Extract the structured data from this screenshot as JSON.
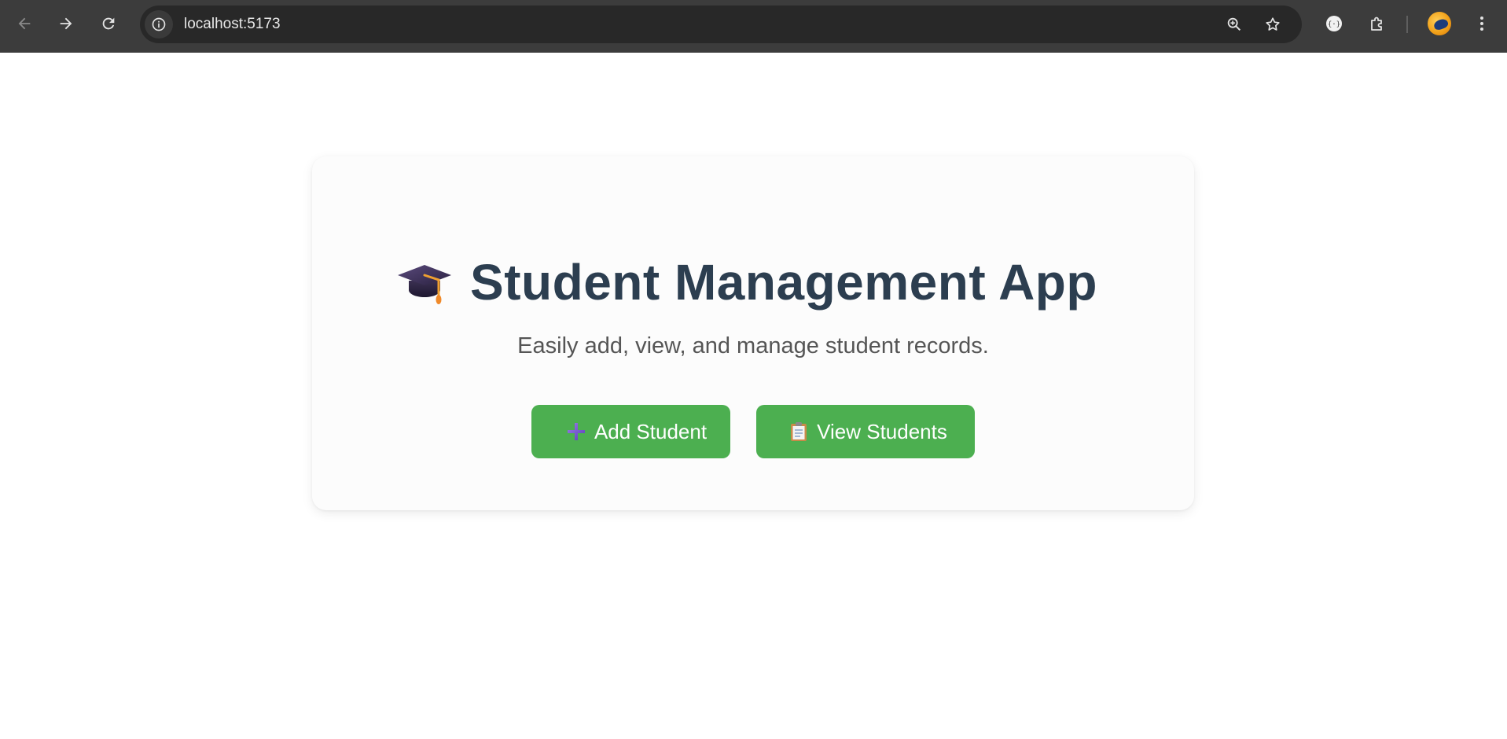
{
  "browser": {
    "url": "localhost:5173",
    "back_icon": "arrow-left-icon",
    "forward_icon": "arrow-right-icon",
    "reload_icon": "reload-icon",
    "site_info_icon": "info-icon",
    "zoom_icon": "zoom-in-icon",
    "bookmark_icon": "star-icon",
    "extension_icons": [
      "web-extension-icon",
      "puzzle-icon"
    ],
    "profile_icon": "avatar",
    "menu_icon": "kebab-menu-icon",
    "colors": {
      "chrome_bg": "#3c3c3c",
      "omnibox_bg": "#282828"
    }
  },
  "app": {
    "title_icon": "graduation-cap-icon",
    "title": "Student Management App",
    "subtitle": "Easily add, view, and manage student records.",
    "buttons": [
      {
        "icon": "plus-icon",
        "label": "Add Student"
      },
      {
        "icon": "clipboard-icon",
        "label": "View Students"
      }
    ],
    "colors": {
      "title": "#2c3e50",
      "button_bg": "#4caf50",
      "button_text": "#ffffff",
      "subtitle": "#555555"
    }
  }
}
